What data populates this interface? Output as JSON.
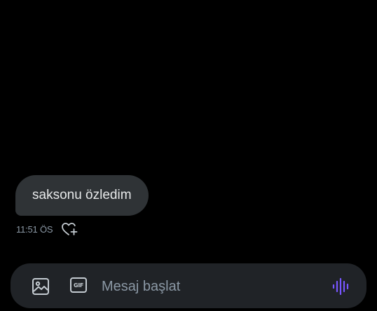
{
  "conversation": {
    "messages": [
      {
        "text": "saksonu özledim",
        "timestamp": "11:51 ÖS"
      }
    ]
  },
  "icons": {
    "reaction": "heart-plus-icon",
    "media": "image-icon",
    "gif": "gif-icon",
    "voice": "voice-waveform-icon"
  },
  "composer": {
    "placeholder": "Mesaj başlat",
    "gif_label": "GIF"
  },
  "colors": {
    "background": "#000000",
    "bubble": "#2f3336",
    "composer": "#202327",
    "accent": "#7856ff",
    "muted_text": "#8b98a5"
  }
}
